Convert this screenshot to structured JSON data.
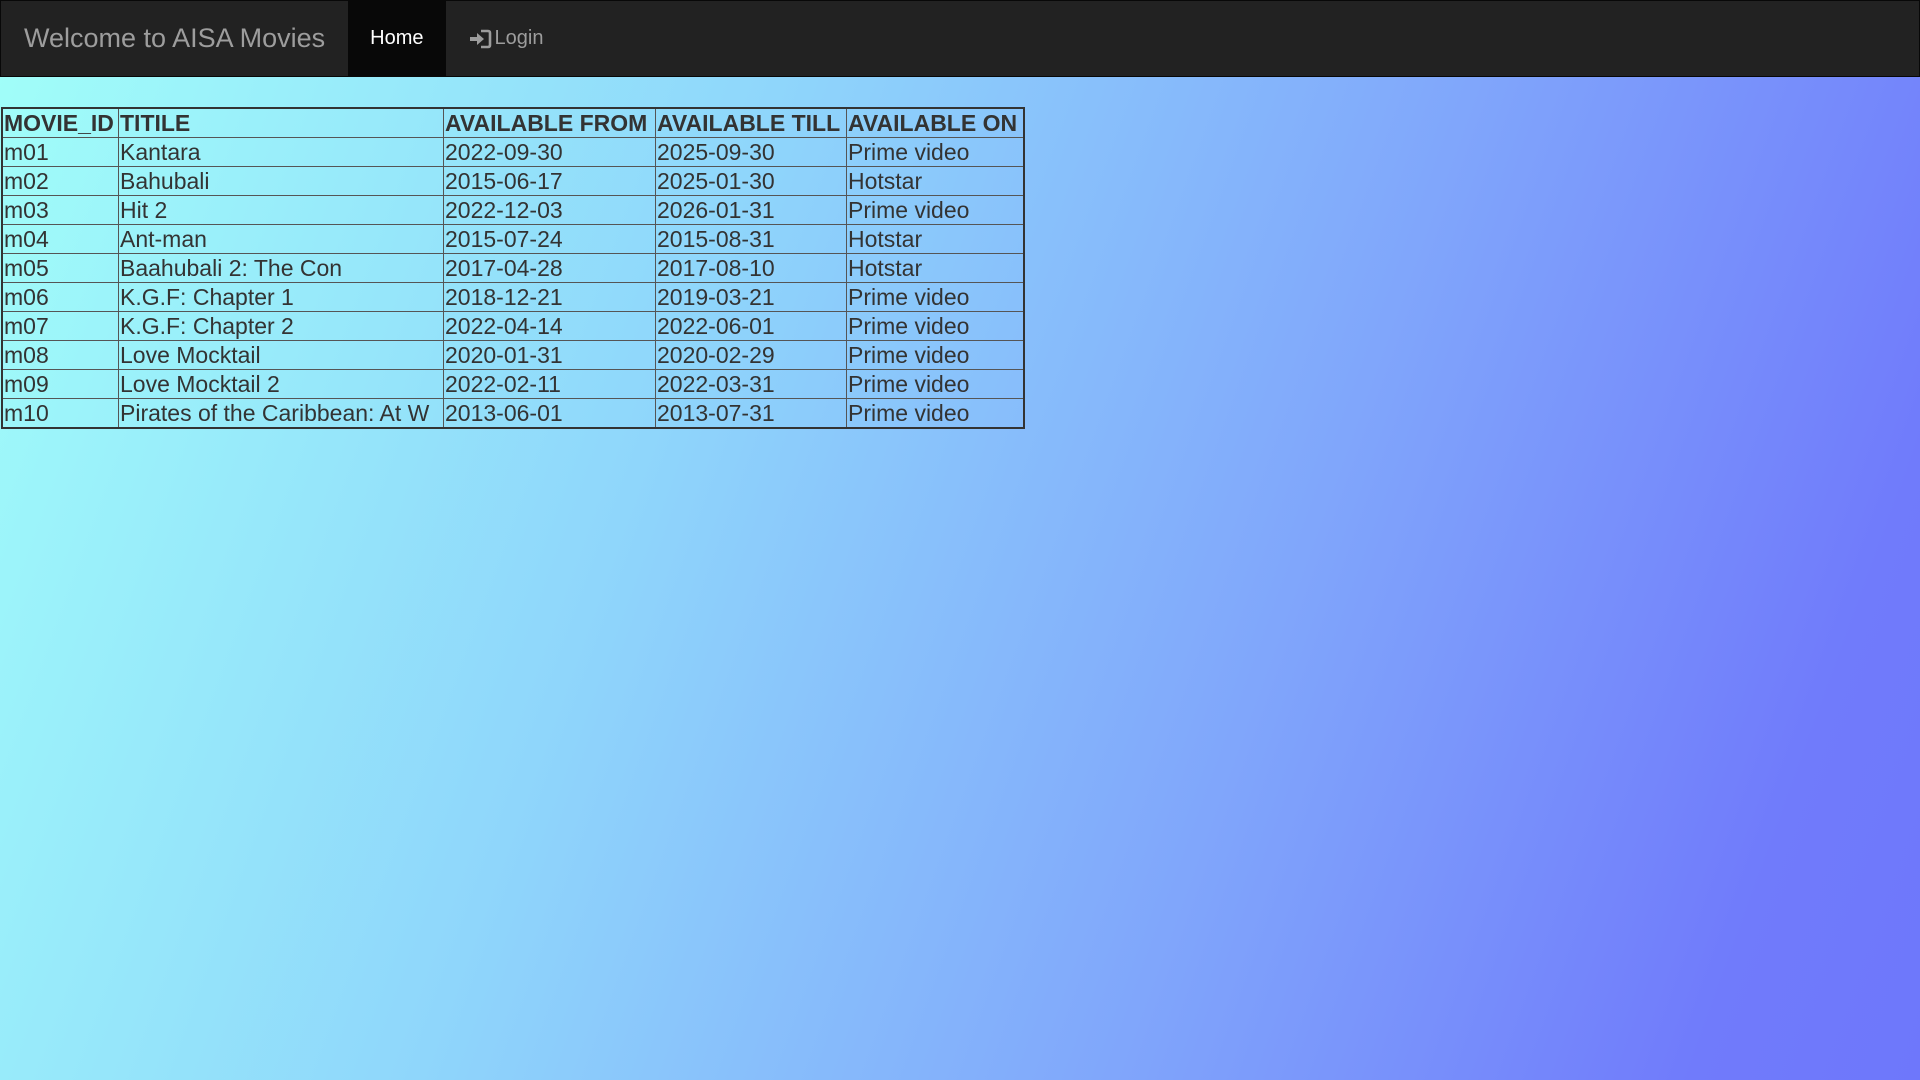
{
  "nav": {
    "brand": "Welcome to AISA Movies",
    "home_label": "Home",
    "login_label": "Login",
    "login_icon": "log-in-icon"
  },
  "table": {
    "headers": [
      "MOVIE_ID",
      "TITILE",
      "AVAILABLE FROM",
      "AVAILABLE TILL",
      "AVAILABLE ON"
    ],
    "rows": [
      [
        "m01",
        "Kantara",
        "2022-09-30",
        "2025-09-30",
        "Prime video"
      ],
      [
        "m02",
        "Bahubali",
        "2015-06-17",
        "2025-01-30",
        "Hotstar"
      ],
      [
        "m03",
        "Hit 2",
        "2022-12-03",
        "2026-01-31",
        "Prime video"
      ],
      [
        "m04",
        "Ant-man",
        "2015-07-24",
        "2015-08-31",
        "Hotstar"
      ],
      [
        "m05",
        "Baahubali 2: The Con",
        "2017-04-28",
        "2017-08-10",
        "Hotstar"
      ],
      [
        "m06",
        "K.G.F: Chapter 1",
        "2018-12-21",
        "2019-03-21",
        "Prime video"
      ],
      [
        "m07",
        "K.G.F: Chapter 2",
        "2022-04-14",
        "2022-06-01",
        "Prime video"
      ],
      [
        "m08",
        "Love Mocktail",
        "2020-01-31",
        "2020-02-29",
        "Prime video"
      ],
      [
        "m09",
        "Love Mocktail 2",
        "2022-02-11",
        "2022-03-31",
        "Prime video"
      ],
      [
        "m10",
        "Pirates of the Caribbean: At W",
        "2013-06-01",
        "2013-07-31",
        "Prime video"
      ]
    ]
  },
  "colors": {
    "navbar_bg": "#222222",
    "active_nav_bg": "#080808",
    "gradient_start": "#a1fff9",
    "gradient_end": "#6e77fb"
  }
}
